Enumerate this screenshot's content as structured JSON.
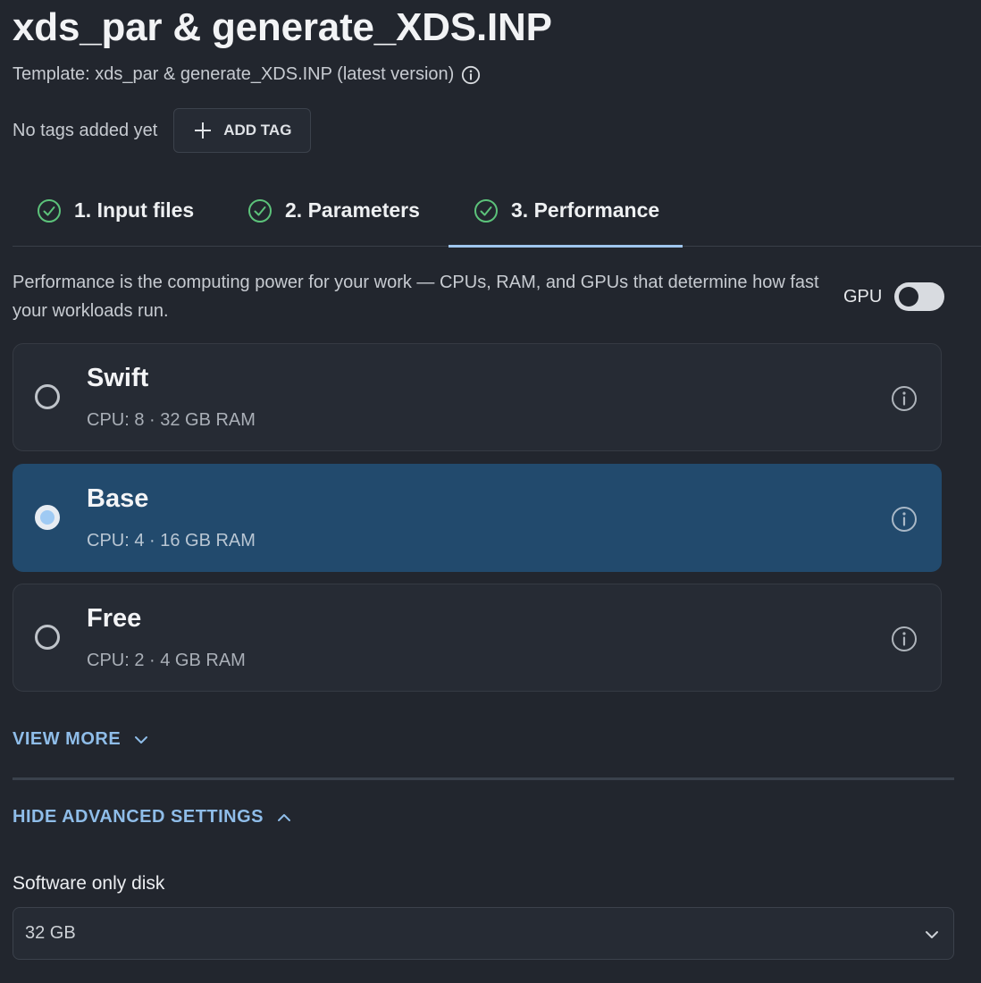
{
  "header": {
    "title": "xds_par & generate_XDS.INP",
    "template_line": "Template: xds_par & generate_XDS.INP (latest version)"
  },
  "tags": {
    "empty_text": "No tags added yet",
    "add_label": "ADD TAG"
  },
  "tabs": [
    {
      "label": "1. Input files",
      "completed": true,
      "active": false
    },
    {
      "label": "2. Parameters",
      "completed": true,
      "active": false
    },
    {
      "label": "3. Performance",
      "completed": true,
      "active": true
    }
  ],
  "performance": {
    "description": "Performance is the computing power for your work — CPUs, RAM, and GPUs that determine how fast your workloads run.",
    "gpu_label": "GPU",
    "gpu_enabled": false,
    "options": [
      {
        "name": "Swift",
        "spec": "CPU: 8 · 32 GB RAM",
        "selected": false
      },
      {
        "name": "Base",
        "spec": "CPU: 4 · 16 GB RAM",
        "selected": true
      },
      {
        "name": "Free",
        "spec": "CPU: 2 · 4 GB RAM",
        "selected": false
      }
    ],
    "view_more_label": "VIEW MORE"
  },
  "advanced": {
    "toggle_label": "HIDE ADVANCED SETTINGS",
    "disk_label": "Software only disk",
    "disk_value": "32 GB"
  },
  "colors": {
    "background": "#22262e",
    "accent": "#8fbde9",
    "selected_card": "#224a6d",
    "check_green": "#5cc27a"
  }
}
